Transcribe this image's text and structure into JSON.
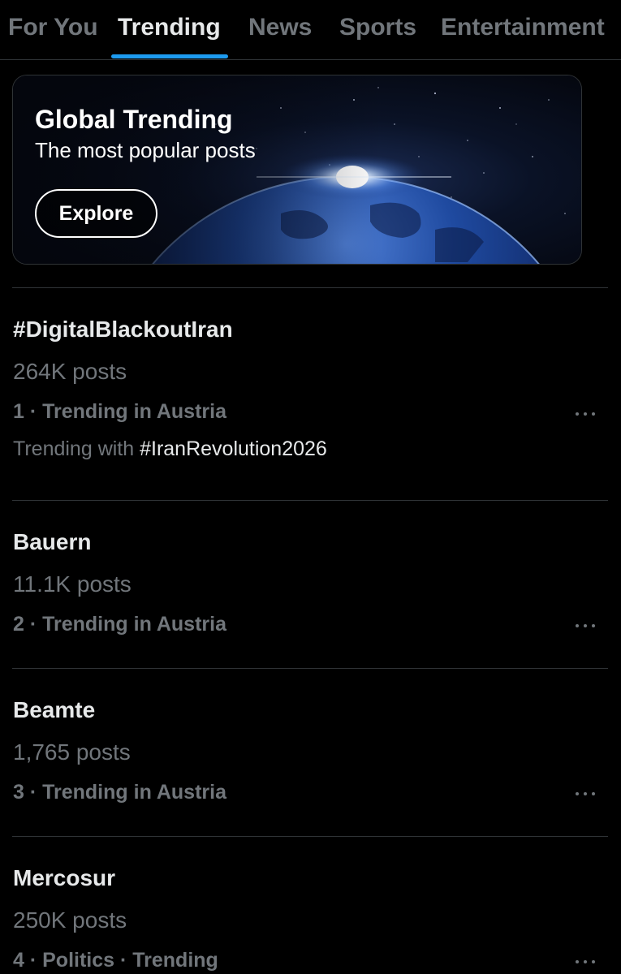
{
  "tabs": [
    {
      "label": "For You"
    },
    {
      "label": "Trending"
    },
    {
      "label": "News"
    },
    {
      "label": "Sports"
    },
    {
      "label": "Entertainment"
    }
  ],
  "active_tab": "Trending",
  "banner": {
    "title": "Global Trending",
    "subtitle": "The most popular posts",
    "button_label": "Explore"
  },
  "trends": [
    {
      "name": "#DigitalBlackoutIran",
      "count": "264K posts",
      "meta": "1 · Trending in Austria",
      "with_prefix": "Trending with ",
      "with_tag": "#IranRevolution2026"
    },
    {
      "name": "Bauern",
      "count": "11.1K posts",
      "meta": "2 · Trending in Austria"
    },
    {
      "name": "Beamte",
      "count": "1,765 posts",
      "meta": "3 · Trending in Austria"
    },
    {
      "name": "Mercosur",
      "count": "250K posts",
      "meta": "4 · Politics · Trending"
    }
  ],
  "icons": {
    "more": "more-horizontal-icon"
  },
  "colors": {
    "background": "#000000",
    "accent": "#1d9bf0",
    "primary_text": "#e7e9ea",
    "secondary_text": "#71767b",
    "border": "#2f3336"
  }
}
